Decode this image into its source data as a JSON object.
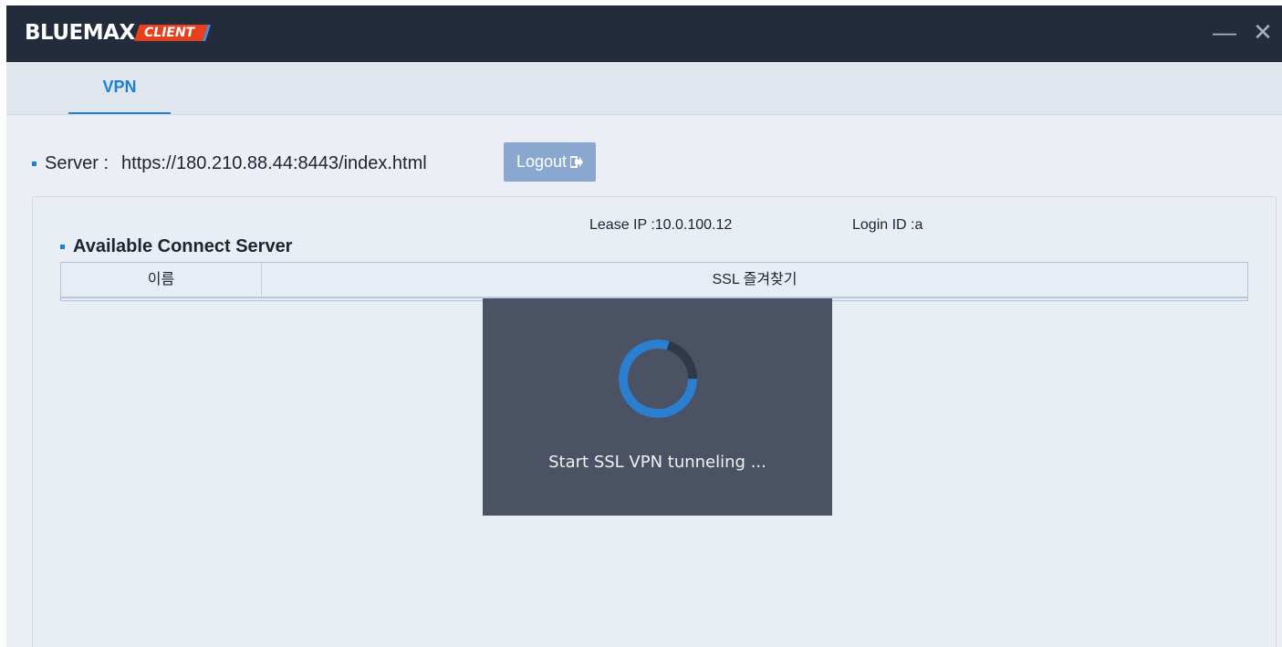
{
  "app": {
    "logo_text": "BLUEMAX",
    "logo_badge": "CLIENT",
    "minimize_glyph": "—",
    "close_glyph": "✕"
  },
  "tabs": [
    {
      "label": "VPN",
      "active": true
    }
  ],
  "server": {
    "label": "Server :",
    "url": "https://180.210.88.44:8443/index.html",
    "logout_label": "Logout",
    "logout_icon": "logout-icon"
  },
  "panel": {
    "title": "Available Connect Server",
    "lease_ip": "Lease IP :10.0.100.12",
    "login_id": "Login ID :a",
    "columns": [
      "이름",
      "SSL 즐겨찾기"
    ]
  },
  "overlay": {
    "message": "Start SSL VPN tunneling ..."
  },
  "colors": {
    "titlebar": "#222c3c",
    "accent": "#1c7fd8",
    "logo_badge": "#e8401c",
    "logout_button": "#8aa8cf",
    "overlay": "#4a5263"
  }
}
